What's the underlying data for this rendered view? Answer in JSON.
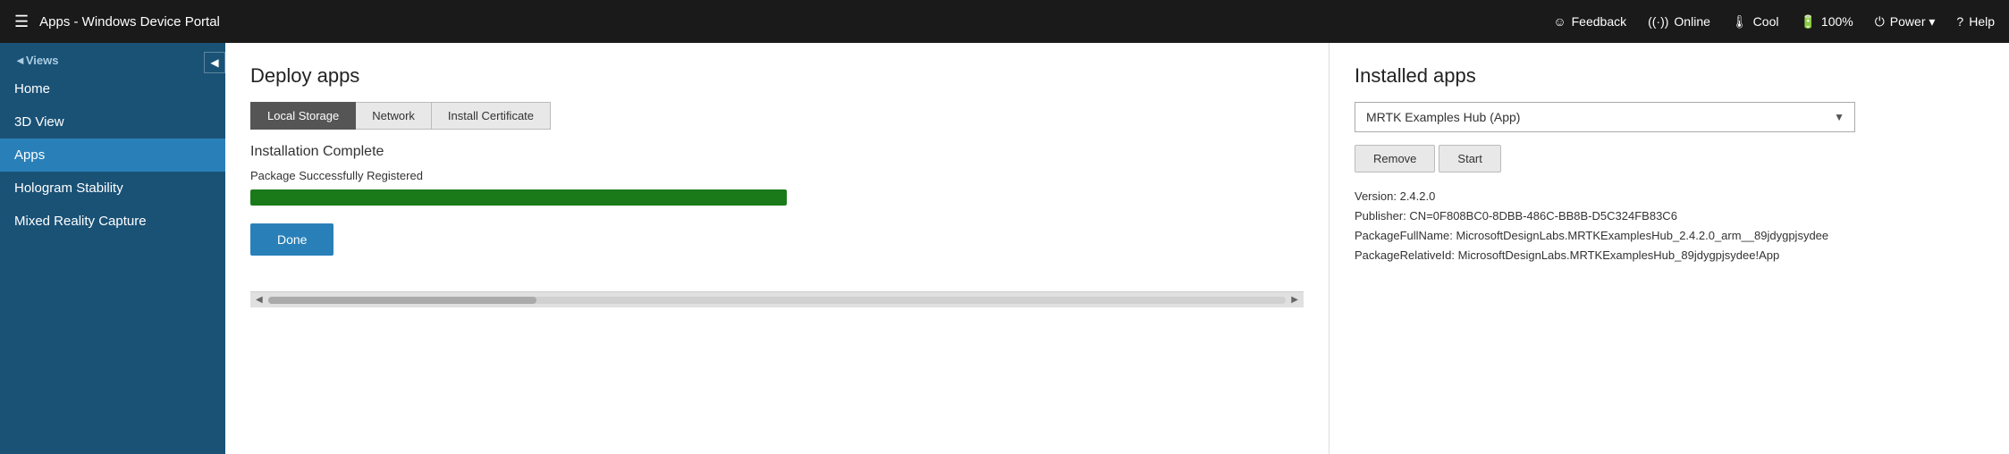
{
  "topbar": {
    "hamburger": "☰",
    "title": "Apps - Windows Device Portal",
    "feedback_icon": "☺",
    "feedback_label": "Feedback",
    "online_icon": "((·))",
    "online_label": "Online",
    "temp_icon": "🌡",
    "temp_label": "Cool",
    "battery_icon": "🔋",
    "battery_label": "100%",
    "power_icon": "⏻",
    "power_label": "Power ▾",
    "help_icon": "?",
    "help_label": "Help"
  },
  "sidebar": {
    "collapse_icon": "◀",
    "views_label": "◄Views",
    "items": [
      {
        "label": "Home",
        "active": false
      },
      {
        "label": "3D View",
        "active": false
      },
      {
        "label": "Apps",
        "active": true
      },
      {
        "label": "Hologram Stability",
        "active": false
      },
      {
        "label": "Mixed Reality Capture",
        "active": false
      }
    ]
  },
  "deploy": {
    "title": "Deploy apps",
    "tabs": [
      {
        "label": "Local Storage",
        "active": true
      },
      {
        "label": "Network",
        "active": false
      },
      {
        "label": "Install Certificate",
        "active": false
      }
    ],
    "install_status": "Installation Complete",
    "package_status": "Package Successfully Registered",
    "progress_percent": 100,
    "done_button": "Done"
  },
  "installed": {
    "title": "Installed apps",
    "selected_app": "MRTK Examples Hub (App)",
    "dropdown_options": [
      "MRTK Examples Hub (App)"
    ],
    "remove_button": "Remove",
    "start_button": "Start",
    "details": {
      "version": "Version: 2.4.2.0",
      "publisher": "Publisher: CN=0F808BC0-8DBB-486C-BB8B-D5C324FB83C6",
      "full_name": "PackageFullName: MicrosoftDesignLabs.MRTKExamplesHub_2.4.2.0_arm__89jdygpjsydee",
      "relative_id": "PackageRelativeId: MicrosoftDesignLabs.MRTKExamplesHub_89jdygpjsydee!App"
    }
  }
}
